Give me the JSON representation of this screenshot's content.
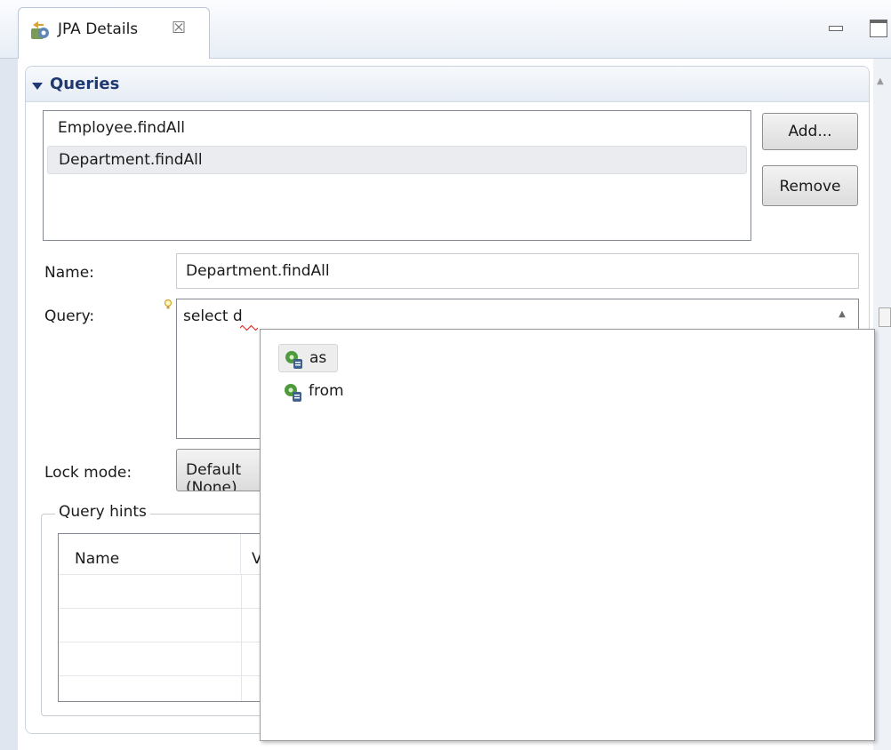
{
  "view": {
    "tab_title": "JPA Details",
    "tab_icon": "jpa-details-icon",
    "close_glyph": "☒"
  },
  "queries_section": {
    "title": "Queries",
    "items": [
      {
        "label": "Employee.findAll"
      },
      {
        "label": "Department.findAll"
      }
    ],
    "selected_index": 1,
    "add_label": "Add...",
    "remove_label": "Remove"
  },
  "form": {
    "name_label": "Name:",
    "name_value": "Department.findAll",
    "query_label": "Query:",
    "query_value": "select d",
    "lock_label": "Lock mode:",
    "lock_value": "Default (None)"
  },
  "query_hints": {
    "title": "Query hints",
    "columns": [
      "Name",
      "Value"
    ]
  },
  "content_assist": {
    "items": [
      {
        "label": "as",
        "icon": "jpql-keyword-icon"
      },
      {
        "label": "from",
        "icon": "jpql-keyword-icon"
      }
    ]
  },
  "colors": {
    "section_title": "#1f3a73",
    "selection": "#eaecf0",
    "border": "#828790"
  }
}
